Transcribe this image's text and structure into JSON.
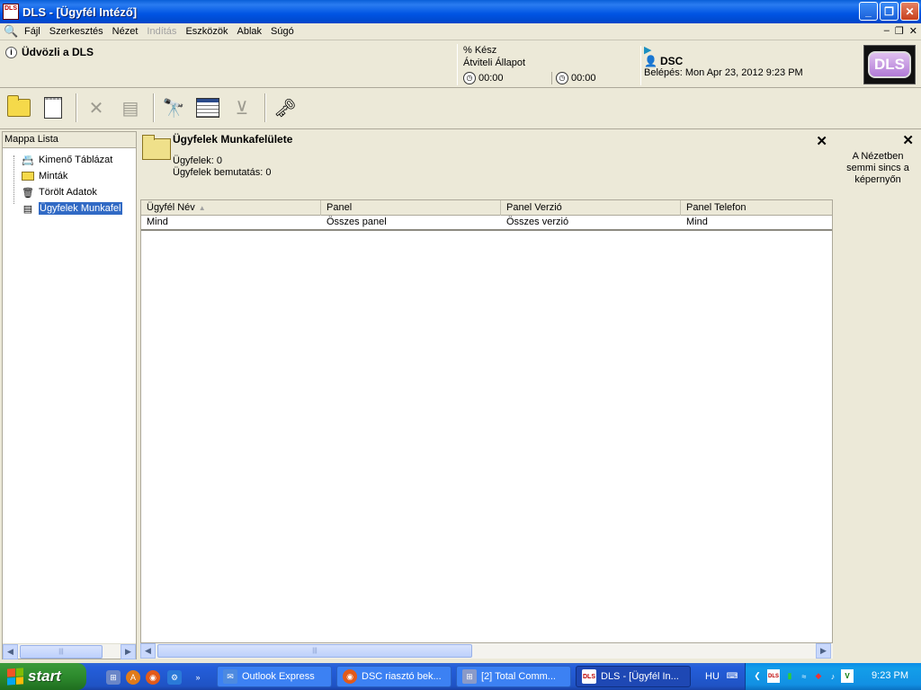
{
  "window": {
    "title": "DLS - [Ügyfél Intéző]",
    "app_icon_text": "DLS",
    "buttons": {
      "minimize": "_",
      "maximize": "❐",
      "close": "✕"
    }
  },
  "menu": {
    "items": [
      {
        "label": "Fájl",
        "enabled": true
      },
      {
        "label": "Szerkesztés",
        "enabled": true
      },
      {
        "label": "Nézet",
        "enabled": true
      },
      {
        "label": "Indítás",
        "enabled": false
      },
      {
        "label": "Eszközök",
        "enabled": true
      },
      {
        "label": "Ablak",
        "enabled": true
      },
      {
        "label": "Súgó",
        "enabled": true
      }
    ],
    "mdi_buttons": {
      "minimize": "–",
      "restore": "❐",
      "close": "✕"
    }
  },
  "info": {
    "welcome": "Üdvözli a DLS",
    "percent_done": "% Kész",
    "transfer_status": "Átviteli Állapot",
    "timer1": "00:00",
    "timer2": "00:00",
    "user": "DSC",
    "login": "Belépés: Mon Apr 23, 2012 9:23 PM",
    "logo_text": "DLS"
  },
  "toolbar": {
    "items": [
      "new-folder-icon",
      "new-document-icon",
      "delete-icon",
      "properties-icon",
      "find-icon",
      "filter-icon",
      "clear-filter-icon",
      "key-card-icon"
    ]
  },
  "left_pane": {
    "title": "Mappa Lista",
    "tree": [
      {
        "label": "Kimenő Táblázat",
        "icon": "outbox-icon",
        "selected": false
      },
      {
        "label": "Minták",
        "icon": "folder-icon",
        "selected": false
      },
      {
        "label": "Törölt Adatok",
        "icon": "trash-icon",
        "selected": false
      },
      {
        "label": "Ügyfelek Munkafel",
        "icon": "workspace-icon",
        "selected": true
      }
    ]
  },
  "workspace": {
    "title": "Ügyfelek Munkafelülete",
    "clients": "Ügyfelek: 0",
    "clients_shown": "Ügyfelek bemutatás: 0",
    "columns": [
      "Ügyfél Név",
      "Panel",
      "Panel Verzió",
      "Panel Telefon"
    ],
    "filter_row": [
      "Mind",
      "Összes panel",
      "Összes verzió",
      "Mind"
    ],
    "sort_column": "Ügyfél Név"
  },
  "right_pane": {
    "message": "A Nézetben semmi sincs a képernyőn"
  },
  "taskbar": {
    "start_label": "start",
    "tasks": [
      {
        "label": "Outlook Express",
        "active": false
      },
      {
        "label": "DSC riasztó bek...",
        "active": false
      },
      {
        "label": "[2] Total Comm...",
        "active": false
      },
      {
        "label": "DLS - [Ügyfél In...",
        "active": true
      }
    ],
    "language": "HU",
    "clock": "9:23 PM"
  },
  "colors": {
    "titlebar": "#0054e3",
    "selection": "#316ac5",
    "window_bg": "#ece9d8",
    "taskbar": "#245edb",
    "start_green": "#2d8a2d"
  }
}
